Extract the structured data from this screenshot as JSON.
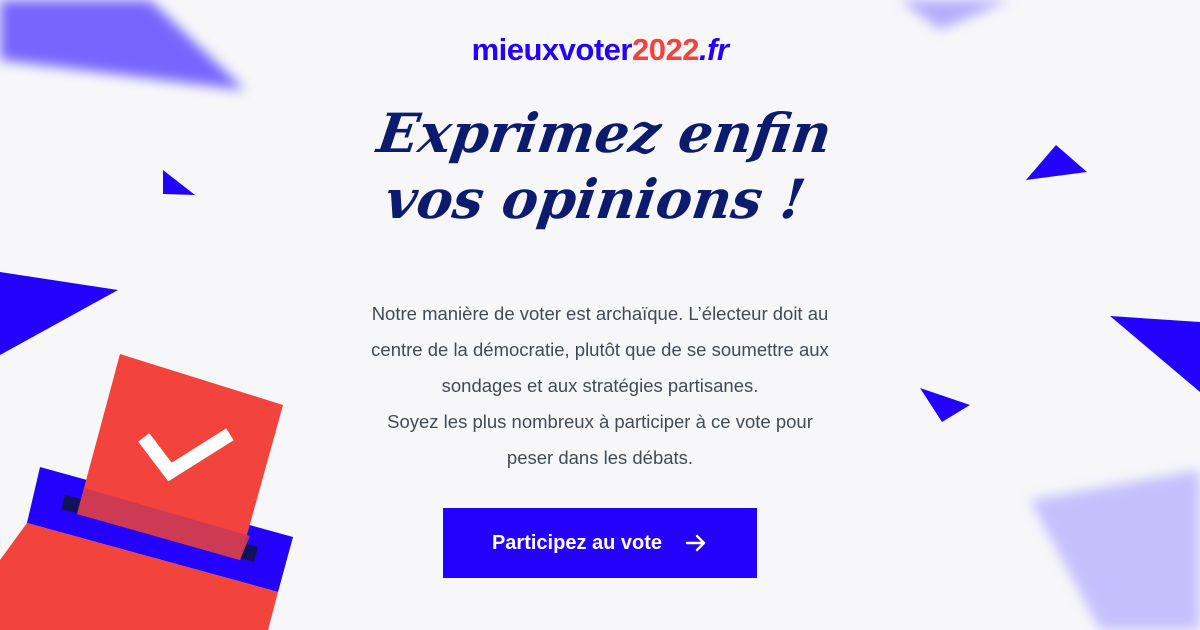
{
  "brand": {
    "name_part1": "mieuxvoter",
    "name_part2": "2022",
    "name_part3": ".fr"
  },
  "headline": {
    "line1": "Exprimez enfin",
    "line2": "vos opinions !"
  },
  "description": {
    "lines": [
      "Notre manière de voter est archaïque. L’électeur doit au",
      "centre de la démocratie, plutôt que de se soumettre aux",
      "sondages et aux stratégies partisanes.",
      "Soyez les plus nombreux à participer à ce vote pour",
      "peser dans les débats."
    ]
  },
  "cta": {
    "label": "Participez au vote",
    "icon": "arrow-right-icon"
  },
  "colors": {
    "brand_blue": "#2400fd",
    "brand_red": "#f2433c",
    "headline_navy": "#0c1b6e",
    "background": "#f7f7f9"
  }
}
